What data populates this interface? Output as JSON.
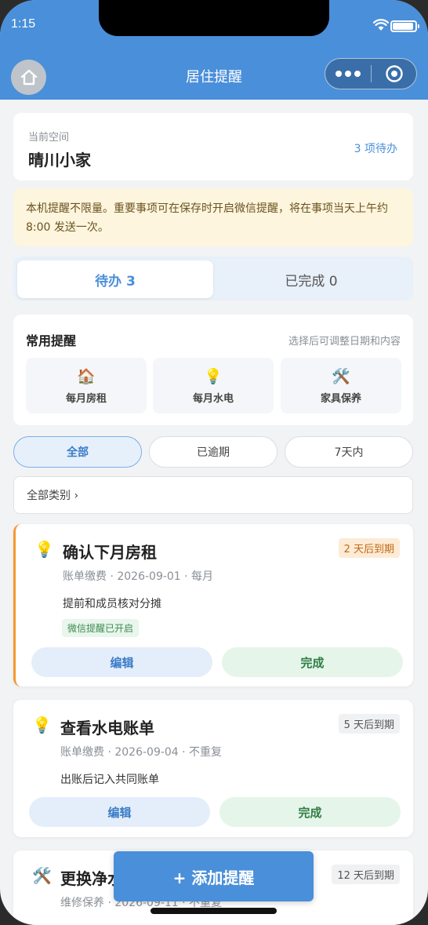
{
  "status_bar": {
    "time": "1:15"
  },
  "nav": {
    "title": "居住提醒"
  },
  "space": {
    "label": "当前空间",
    "name": "晴川小家",
    "pending": "3 项待办"
  },
  "notice": "本机提醒不限量。重要事项可在保存时开启微信提醒，将在事项当天上午约 8:00 发送一次。",
  "tabs": {
    "todo": "待办 3",
    "done": "已完成 0"
  },
  "quick": {
    "title": "常用提醒",
    "hint": "选择后可调整日期和内容",
    "items": [
      {
        "icon": "🏠",
        "label": "每月房租"
      },
      {
        "icon": "💡",
        "label": "每月水电"
      },
      {
        "icon": "🛠️",
        "label": "家具保养"
      }
    ]
  },
  "filters": [
    "全部",
    "已逾期",
    "7天内"
  ],
  "category": "全部类别 ›",
  "reminders": [
    {
      "icon": "💡",
      "title": "确认下月房租",
      "badge": "2 天后到期",
      "meta": "账单缴费 · 2026-09-01 · 每月",
      "note": "提前和成员核对分摊",
      "tag": "微信提醒已开启"
    },
    {
      "icon": "💡",
      "title": "查看水电账单",
      "badge": "5 天后到期",
      "meta": "账单缴费 · 2026-09-04 · 不重复",
      "note": "出账后记入共同账单"
    },
    {
      "icon": "🛠️",
      "title": "更换净水",
      "badge": "12 天后到期",
      "meta": "维修保养 · 2026-09-11 · 不重复"
    }
  ],
  "actions": {
    "edit": "编辑",
    "done": "完成"
  },
  "fab": "+ 添加提醒",
  "colors": {
    "primary": "#4a8fd9",
    "warn": "#f59a2f",
    "success": "#2f7d45"
  }
}
